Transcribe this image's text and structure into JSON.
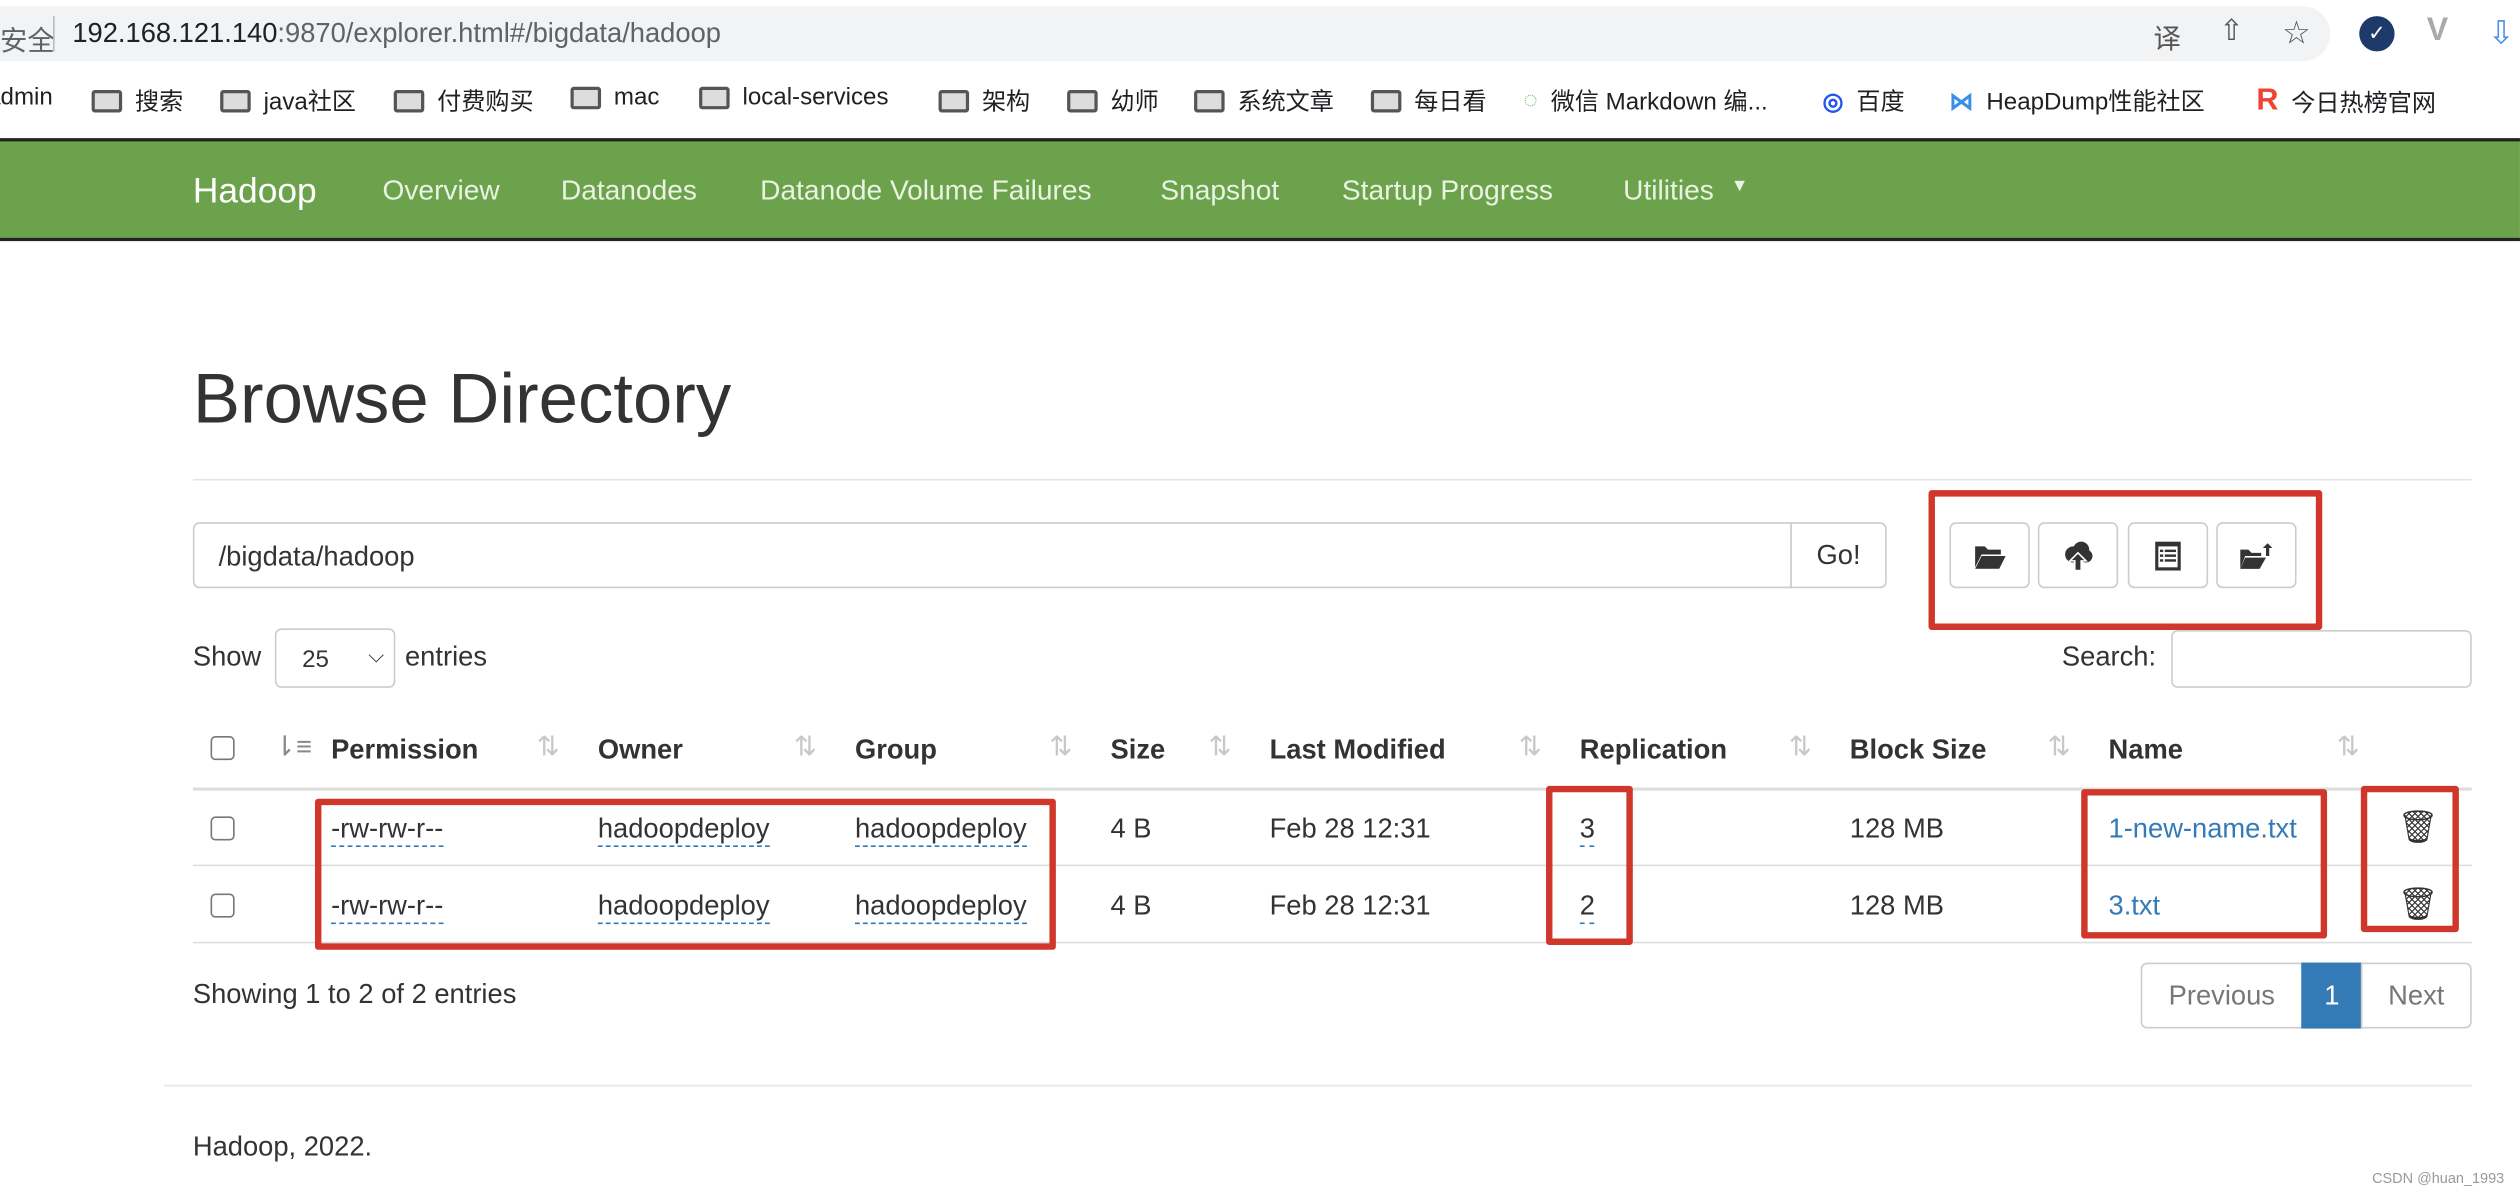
{
  "browser": {
    "security_label": "安全",
    "url_host": "192.168.121.140",
    "url_rest": ":9870/explorer.html#/bigdata/hadoop",
    "bookmarks": [
      "admin",
      "搜索",
      "java社区",
      "付费购买",
      "mac",
      "local-services",
      "架构",
      "幼师",
      "系统文章",
      "每日看",
      "微信 Markdown 编...",
      "百度",
      "HeapDump性能社区",
      "今日热榜官网"
    ]
  },
  "nav": {
    "brand": "Hadoop",
    "items": [
      "Overview",
      "Datanodes",
      "Datanode Volume Failures",
      "Snapshot",
      "Startup Progress",
      "Utilities"
    ],
    "color": "#6ca24c"
  },
  "page": {
    "title": "Browse Directory",
    "path_value": "/bigdata/hadoop",
    "go_label": "Go!",
    "toolbar": [
      "folder-open-icon",
      "cloud-upload-icon",
      "list-alt-icon",
      "folder-move-up-icon"
    ],
    "show_label": "Show",
    "entries_value": "25",
    "entries_label": "entries",
    "search_label": "Search:",
    "search_value": ""
  },
  "table": {
    "columns": [
      "Permission",
      "Owner",
      "Group",
      "Size",
      "Last Modified",
      "Replication",
      "Block Size",
      "Name"
    ],
    "rows": [
      {
        "permission": "-rw-rw-r--",
        "owner": "hadoopdeploy",
        "group": "hadoopdeploy",
        "size": "4 B",
        "modified": "Feb 28 12:31",
        "replication": "3",
        "block_size": "128 MB",
        "name": "1-new-name.txt"
      },
      {
        "permission": "-rw-rw-r--",
        "owner": "hadoopdeploy",
        "group": "hadoopdeploy",
        "size": "4 B",
        "modified": "Feb 28 12:31",
        "replication": "2",
        "block_size": "128 MB",
        "name": "3.txt"
      }
    ]
  },
  "info": "Showing 1 to 2 of 2 entries",
  "pagination": {
    "previous": "Previous",
    "current": "1",
    "next": "Next",
    "accent": "#337ab7"
  },
  "footer": "Hadoop, 2022.",
  "watermark": "CSDN @huan_1993",
  "annotation_color": "#d0372a"
}
